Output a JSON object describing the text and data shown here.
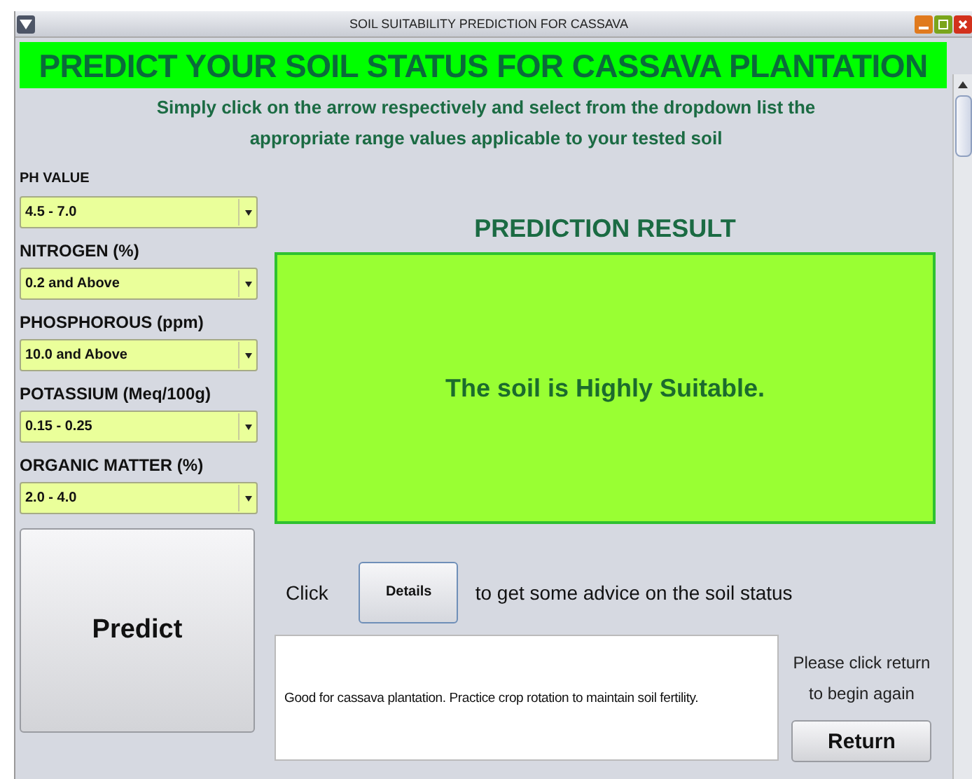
{
  "window": {
    "title": "SOIL SUITABILITY PREDICTION FOR CASSAVA"
  },
  "header": {
    "title": "PREDICT YOUR SOIL STATUS FOR CASSAVA PLANTATION",
    "instructions": [
      "Simply click on the arrow respectively and select  from the dropdown list the",
      "appropriate range values applicable to your tested soil"
    ]
  },
  "fields": [
    {
      "label": "PH VALUE",
      "value": "4.5 - 7.0"
    },
    {
      "label": "NITROGEN (%)",
      "value": "0.2 and Above"
    },
    {
      "label": "PHOSPHOROUS (ppm)",
      "value": "10.0 and Above"
    },
    {
      "label": "POTASSIUM (Meq/100g)",
      "value": "0.15 - 0.25"
    },
    {
      "label": "ORGANIC MATTER (%)",
      "value": "2.0 - 4.0"
    }
  ],
  "predict_button": "Predict",
  "result": {
    "title": "PREDICTION RESULT",
    "message": "The soil is Highly Suitable."
  },
  "details": {
    "prefix": "Click",
    "button": "Details",
    "suffix": "to get some advice on the soil status"
  },
  "advice": "Good for cassava plantation. Practice crop rotation to maintain soil fertility.",
  "return": {
    "hint": "Please click return to begin again",
    "button": "Return"
  }
}
